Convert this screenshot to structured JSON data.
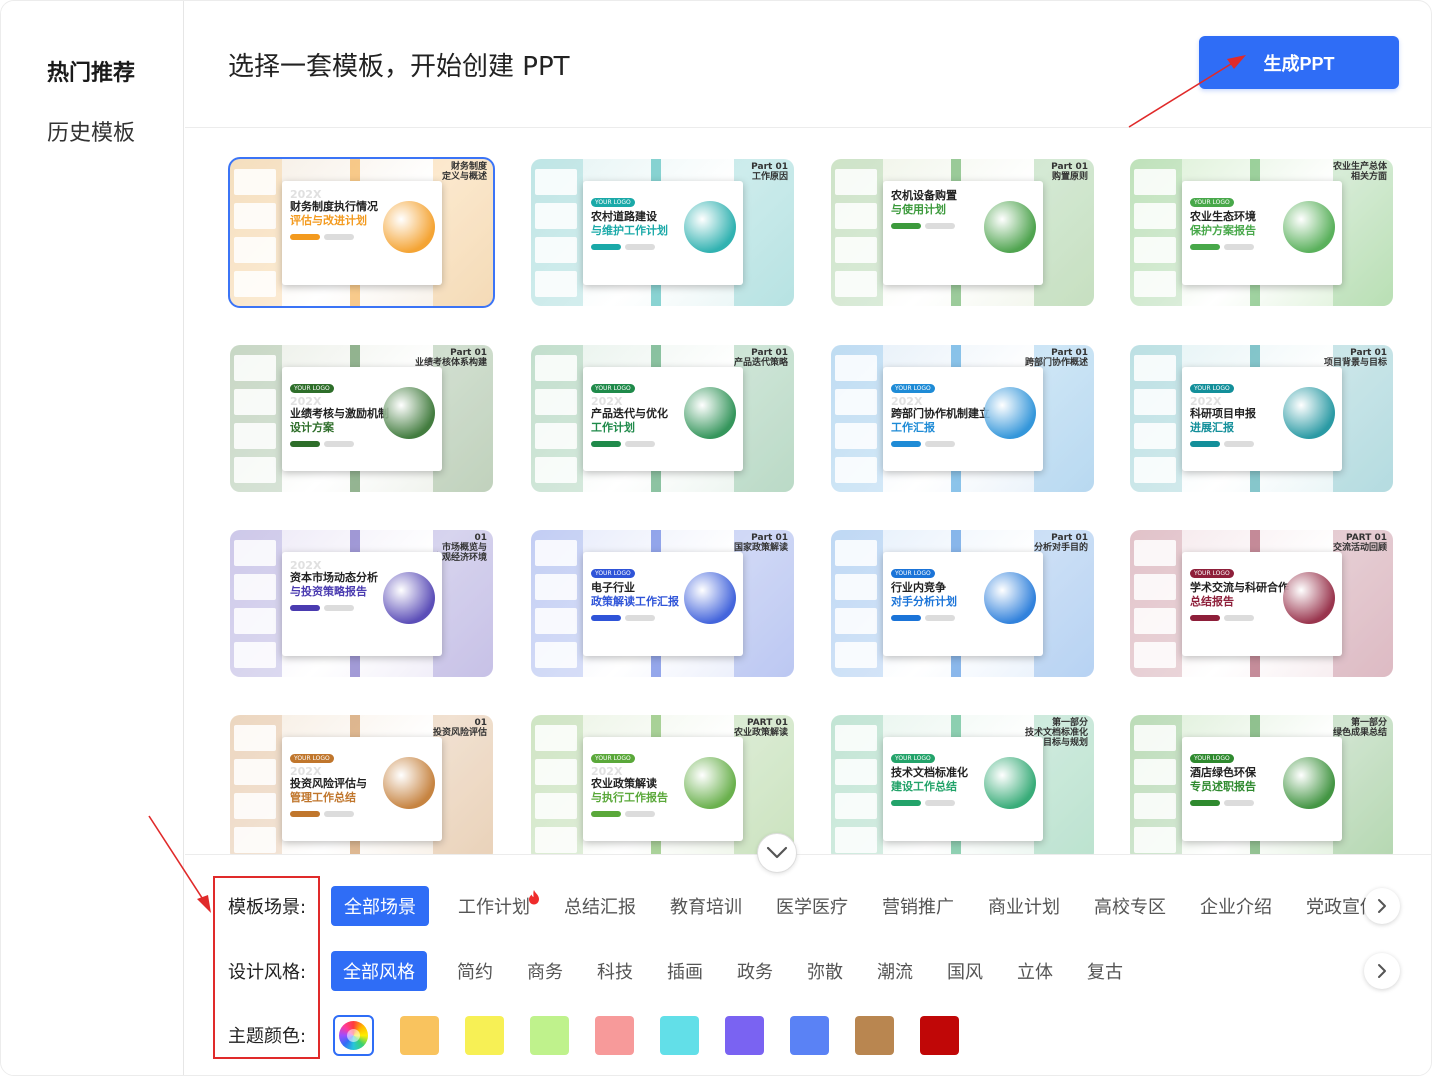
{
  "sidebar": {
    "items": [
      {
        "label": "热门推荐",
        "active": true
      },
      {
        "label": "历史模板",
        "active": false
      }
    ]
  },
  "header": {
    "title": "选择一套模板，开始创建 PPT",
    "generate_label": "生成PPT"
  },
  "templates": [
    {
      "title1": "财务制度执行情况",
      "title2": "评估与改进计划",
      "year": "202X",
      "accent": "#f39a1e",
      "bg": "#f5ede2",
      "part": "财务制度\n定义与概述",
      "selected": true
    },
    {
      "title1": "农村道路建设",
      "title2": "与维护工作计划",
      "year": "",
      "accent": "#1aa9a8",
      "bg": "#e3f3f3",
      "part": "Part 01\n工作原因",
      "logo": "YOUR LOGO"
    },
    {
      "title1": "农机设备购置",
      "title2": "与使用计划",
      "year": "",
      "accent": "#3c9a3c",
      "bg": "#eef3e6",
      "part": "Part 01\n购置原则"
    },
    {
      "title1": "农业生态环境",
      "title2": "保护方案报告",
      "year": "",
      "accent": "#48a84a",
      "bg": "#d9efd3",
      "part": "农业生产总体\n相关方面",
      "logo": "YOUR LOGO"
    },
    {
      "title1": "业绩考核与激励机制",
      "title2": "设计方案",
      "year": "202X",
      "accent": "#2e6e2a",
      "bg": "#eaeee6",
      "part": "Part 01\n业绩考核体系构建",
      "logo": "YOUR LOGO"
    },
    {
      "title1": "产品迭代与优化",
      "title2": "工作计划",
      "year": "202X",
      "accent": "#1f8a4a",
      "bg": "#e6f1ea",
      "part": "Part 01\n产品迭代策略",
      "logo": "YOUR LOGO"
    },
    {
      "title1": "跨部门协作机制建立",
      "title2": "工作汇报",
      "year": "202X",
      "accent": "#1e8bd6",
      "bg": "#e3eef8",
      "part": "Part 01\n跨部门协作概述",
      "logo": "YOUR LOGO"
    },
    {
      "title1": "科研项目申报",
      "title2": "进展汇报",
      "year": "202X",
      "accent": "#138f9a",
      "bg": "#e2f2f4",
      "part": "Part 01\n项目背景与目标",
      "logo": "YOUR LOGO"
    },
    {
      "title1": "资本市场动态分析",
      "title2": "与投资策略报告",
      "year": "202X",
      "accent": "#4a3bb0",
      "bg": "#ebe7f6",
      "part": "01\n市场概览与\n宏观经济环境"
    },
    {
      "title1": "电子行业",
      "title2": "政策解读工作汇报",
      "year": "",
      "accent": "#2f54d8",
      "bg": "#e4e9fa",
      "part": "Part 01\n国家政策解读",
      "logo": "YOUR LOGO"
    },
    {
      "title1": "行业内竞争",
      "title2": "对手分析计划",
      "year": "",
      "accent": "#1b74d8",
      "bg": "#e3eefb",
      "part": "Part 01\n分析对手目的",
      "logo": "YOUR LOGO"
    },
    {
      "title1": "学术交流与科研合作",
      "title2": "总结报告",
      "year": "",
      "accent": "#8e1f3a",
      "bg": "#f4e6ea",
      "part": "PART 01\n交流活动回顾",
      "logo": "YOUR LOGO"
    },
    {
      "title1": "投资风险评估与",
      "title2": "管理工作总结",
      "year": "202X",
      "accent": "#c0762c",
      "bg": "#f6ece0",
      "part": "01\n投资风险评估",
      "logo": "YOUR LOGO"
    },
    {
      "title1": "农业政策解读",
      "title2": "与执行工作报告",
      "year": "202X",
      "accent": "#5aa83a",
      "bg": "#eaf3e3",
      "part": "PART 01\n农业政策解读",
      "logo": "YOUR LOGO"
    },
    {
      "title1": "技术文档标准化",
      "title2": "建设工作总结",
      "year": "",
      "accent": "#23a36a",
      "bg": "#e6f4ec",
      "part": "第一部分\n技术文档标准化\n的目标与规划",
      "logo": "YOUR LOGO"
    },
    {
      "title1": "酒店绿色环保",
      "title2": "专员述职报告",
      "year": "",
      "accent": "#2f8a2f",
      "bg": "#dbeed6",
      "part": "第一部分\n绿色成果总结",
      "logo": "YOUR LOGO"
    }
  ],
  "filters": {
    "scene": {
      "label": "模板场景:",
      "options": [
        "全部场景",
        "工作计划",
        "总结汇报",
        "教育培训",
        "医学医疗",
        "营销推广",
        "商业计划",
        "高校专区",
        "企业介绍",
        "党政宣传"
      ],
      "active": "全部场景",
      "hot": "工作计划"
    },
    "style": {
      "label": "设计风格:",
      "options": [
        "全部风格",
        "简约",
        "商务",
        "科技",
        "插画",
        "政务",
        "弥散",
        "潮流",
        "国风",
        "立体",
        "复古"
      ],
      "active": "全部风格"
    },
    "color": {
      "label": "主题颜色:",
      "swatches": [
        "all",
        "#f9c35e",
        "#f7f055",
        "#bff28c",
        "#f79a9a",
        "#62dfe8",
        "#7a63f2",
        "#5a82f5",
        "#b98650",
        "#c00707"
      ]
    }
  },
  "icons": {
    "scroll_down": "chevron-down-icon",
    "next": "chevron-right-icon",
    "hot": "fire-icon"
  }
}
